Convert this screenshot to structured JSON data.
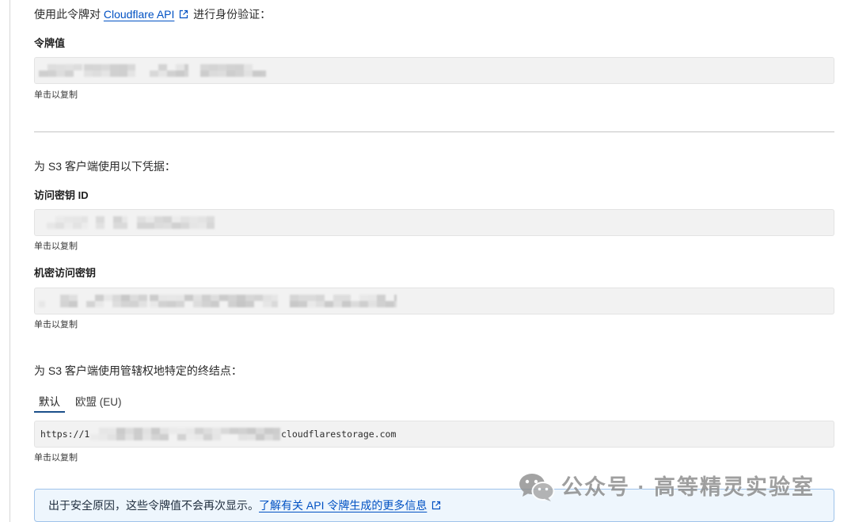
{
  "api_token": {
    "intro_prefix": "使用此令牌对",
    "intro_link": "Cloudflare API",
    "intro_suffix": "进行身份验证：",
    "label": "令牌值",
    "copy_hint": "单击以复制"
  },
  "s3_credentials": {
    "intro": "为 S3 客户端使用以下凭据：",
    "access_key_label": "访问密钥 ID",
    "access_key_copy_hint": "单击以复制",
    "secret_key_label": "机密访问密钥",
    "secret_key_copy_hint": "单击以复制"
  },
  "endpoints": {
    "intro": "为 S3 客户端使用管辖权地特定的终结点：",
    "tabs": [
      {
        "label": "默认",
        "active": true
      },
      {
        "label": "欧盟 (EU)",
        "active": false
      }
    ],
    "url_prefix": "https://1",
    "url_suffix": "cloudflarestorage.com",
    "copy_hint": "单击以复制"
  },
  "notice": {
    "text": "出于安全原因，这些令牌值不会再次显示。",
    "link": "了解有关 API 令牌生成的更多信息"
  },
  "watermark": {
    "text": "公众号 · 高等精灵实验室"
  },
  "icons": {
    "external_link": "external-link-icon",
    "watermark_logo": "wechat-icon"
  },
  "colors": {
    "link": "#0051c3",
    "text": "#313131",
    "field_background": "#f2f2f2",
    "notice_background": "#eef6fd",
    "notice_border": "#9fc3ea",
    "active_tab_underline": "#1b4f8a"
  }
}
